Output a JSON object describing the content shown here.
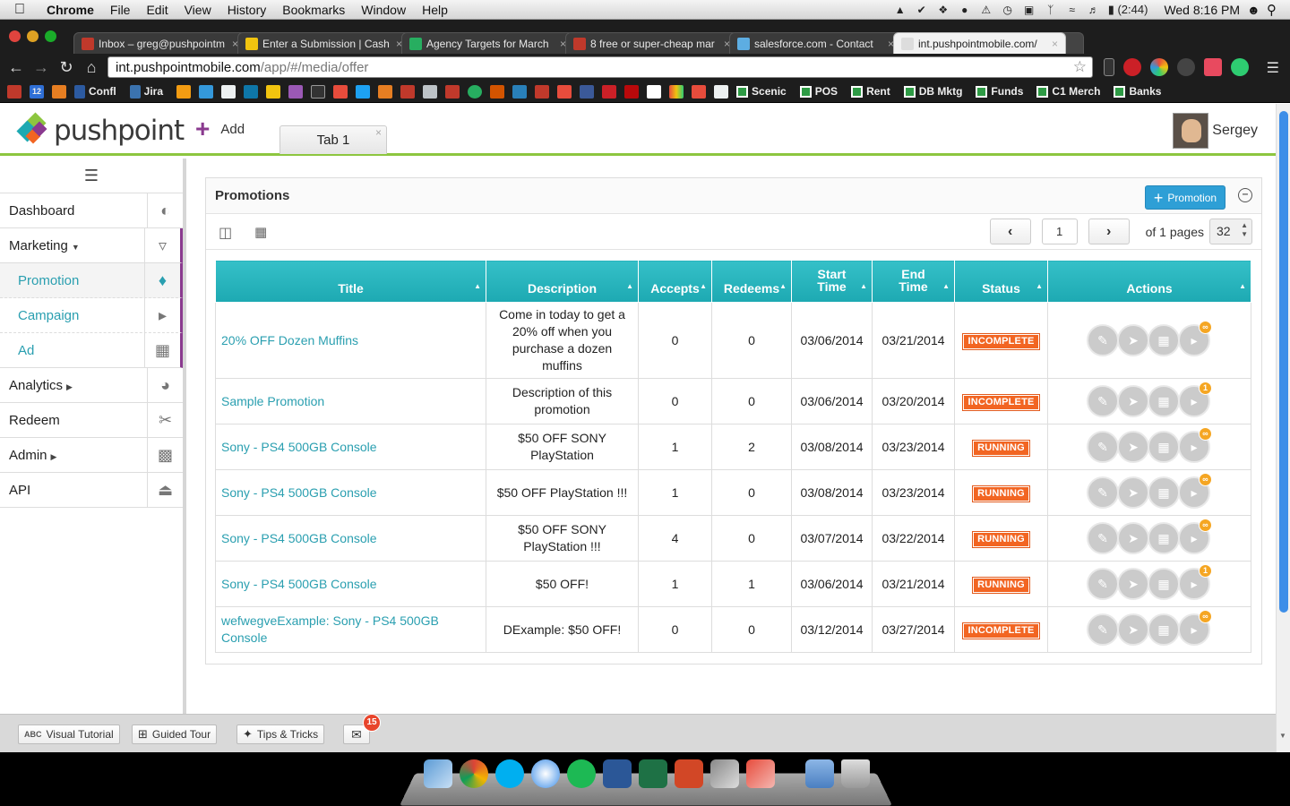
{
  "menubar": {
    "app": "Chrome",
    "items": [
      "File",
      "Edit",
      "View",
      "History",
      "Bookmarks",
      "Window",
      "Help"
    ],
    "battery": "(2:44)",
    "clock": "Wed 8:16 PM"
  },
  "tabs": [
    {
      "title": "Inbox – greg@pushpointm",
      "fav": "#c0392b"
    },
    {
      "title": "Enter a Submission | Cash",
      "fav": "#f1c40f"
    },
    {
      "title": "Agency Targets for March",
      "fav": "#27ae60"
    },
    {
      "title": "8 free or super-cheap mar",
      "fav": "#c0392b"
    },
    {
      "title": "salesforce.com - Contact",
      "fav": "#5dade2"
    },
    {
      "title": "int.pushpointmobile.com/",
      "fav": "#dddddd"
    }
  ],
  "address": {
    "host": "int.pushpointmobile.com",
    "path": "/app/#/media/offer"
  },
  "bookmarks": {
    "confl": "Confl",
    "jira": "Jira",
    "badge_num": "12",
    "sheets": [
      "Scenic",
      "POS",
      "Rent",
      "DB Mktg",
      "Funds",
      "C1 Merch",
      "Banks"
    ]
  },
  "header": {
    "logo": "pushpoint",
    "add": "Add",
    "tab": "Tab 1",
    "user": "Sergey"
  },
  "sidebar": {
    "items": [
      {
        "label": "Dashboard"
      },
      {
        "label": "Marketing"
      },
      {
        "label": "Promotion"
      },
      {
        "label": "Campaign"
      },
      {
        "label": "Ad"
      },
      {
        "label": "Analytics"
      },
      {
        "label": "Redeem"
      },
      {
        "label": "Admin"
      },
      {
        "label": "API"
      }
    ]
  },
  "panel": {
    "title": "Promotions",
    "new_button": "Promotion",
    "pager": {
      "page": "1",
      "of_label": "of 1 pages",
      "page_size": "32"
    }
  },
  "table": {
    "columns": [
      "Title",
      "Description",
      "Accepts",
      "Redeems",
      "Start Time",
      "End Time",
      "Status",
      "Actions"
    ],
    "rows": [
      {
        "title": "20% OFF Dozen Muffins",
        "desc": "Come in today to get a 20% off when you purchase a dozen muffins",
        "accepts": "0",
        "redeems": "0",
        "start": "03/06/2014",
        "end": "03/21/2014",
        "status": "INCOMPLETE",
        "badge": ""
      },
      {
        "title": "Sample Promotion",
        "desc": "Description of this promotion",
        "accepts": "0",
        "redeems": "0",
        "start": "03/06/2014",
        "end": "03/20/2014",
        "status": "INCOMPLETE",
        "badge": "1"
      },
      {
        "title": "Sony - PS4 500GB Console",
        "desc": "$50 OFF SONY PlayStation",
        "accepts": "1",
        "redeems": "2",
        "start": "03/08/2014",
        "end": "03/23/2014",
        "status": "RUNNING",
        "badge": ""
      },
      {
        "title": "Sony - PS4 500GB Console",
        "desc": "$50 OFF PlayStation !!!",
        "accepts": "1",
        "redeems": "0",
        "start": "03/08/2014",
        "end": "03/23/2014",
        "status": "RUNNING",
        "badge": ""
      },
      {
        "title": "Sony - PS4 500GB Console",
        "desc": "$50 OFF SONY PlayStation !!!",
        "accepts": "4",
        "redeems": "0",
        "start": "03/07/2014",
        "end": "03/22/2014",
        "status": "RUNNING",
        "badge": ""
      },
      {
        "title": "Sony - PS4 500GB Console",
        "desc": "$50 OFF!",
        "accepts": "1",
        "redeems": "1",
        "start": "03/06/2014",
        "end": "03/21/2014",
        "status": "RUNNING",
        "badge": "1"
      },
      {
        "title": "wefwegveExample: Sony - PS4 500GB Console",
        "desc": "DExample: $50 OFF!",
        "accepts": "0",
        "redeems": "0",
        "start": "03/12/2014",
        "end": "03/27/2014",
        "status": "INCOMPLETE",
        "badge": ""
      }
    ]
  },
  "footer": {
    "visual_tutorial_icon": "ABC",
    "visual_tutorial": "Visual Tutorial",
    "guided_tour": "Guided Tour",
    "tips": "Tips & Tricks",
    "mail_count": "15"
  },
  "colors": {
    "accent_teal": "#1da9b2",
    "brand_green": "#8dc63f",
    "brand_purple": "#8a3a8f",
    "status": "#f26522",
    "button_blue": "#2e9fd6"
  }
}
